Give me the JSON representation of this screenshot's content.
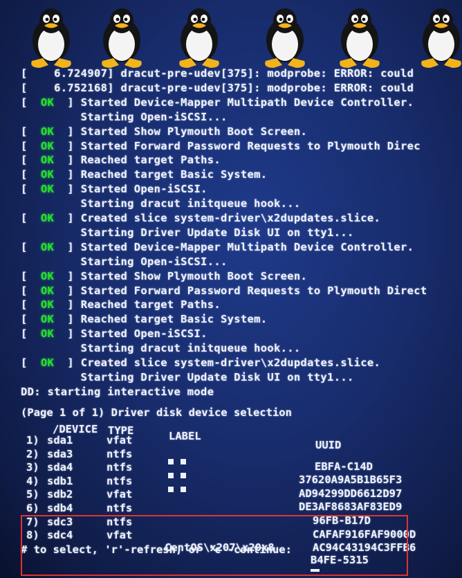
{
  "boot_log": [
    {
      "status": "",
      "text": "[    6.724907] dracut-pre-udev[375]: modprobe: ERROR: could"
    },
    {
      "status": "",
      "text": "[    6.752168] dracut-pre-udev[375]: modprobe: ERROR: could"
    },
    {
      "status": "OK",
      "text": "Started Device-Mapper Multipath Device Controller."
    },
    {
      "status": "",
      "text": "         Starting Open-iSCSI..."
    },
    {
      "status": "OK",
      "text": "Started Show Plymouth Boot Screen."
    },
    {
      "status": "OK",
      "text": "Started Forward Password Requests to Plymouth Direc"
    },
    {
      "status": "OK",
      "text": "Reached target Paths."
    },
    {
      "status": "OK",
      "text": "Reached target Basic System."
    },
    {
      "status": "OK",
      "text": "Started Open-iSCSI."
    },
    {
      "status": "",
      "text": "         Starting dracut initqueue hook..."
    },
    {
      "status": "OK",
      "text": "Created slice system-driver\\x2dupdates.slice."
    },
    {
      "status": "",
      "text": "         Starting Driver Update Disk UI on tty1..."
    },
    {
      "status": "OK",
      "text": "Started Device-Mapper Multipath Device Controller."
    },
    {
      "status": "",
      "text": "         Starting Open-iSCSI..."
    },
    {
      "status": "OK",
      "text": "Started Show Plymouth Boot Screen."
    },
    {
      "status": "OK",
      "text": "Started Forward Password Requests to Plymouth Direct"
    },
    {
      "status": "OK",
      "text": "Reached target Paths."
    },
    {
      "status": "OK",
      "text": "Reached target Basic System."
    },
    {
      "status": "OK",
      "text": "Started Open-iSCSI."
    },
    {
      "status": "",
      "text": "         Starting dracut initqueue hook..."
    },
    {
      "status": "OK",
      "text": "Created slice system-driver\\x2dupdates.slice."
    },
    {
      "status": "",
      "text": "         Starting Driver Update Disk UI on tty1..."
    },
    {
      "status": "",
      "text": "DD: starting interactive mode"
    }
  ],
  "selection": {
    "heading": "(Page 1 of 1) Driver disk device selection",
    "headers": {
      "device": "/DEVICE",
      "type": "TYPE",
      "label": "LABEL",
      "uuid": "UUID"
    },
    "rows": [
      {
        "num": "1)",
        "device": "sda1",
        "type": "vfat",
        "label": "",
        "uuid": ""
      },
      {
        "num": "2)",
        "device": "sda3",
        "type": "ntfs",
        "label": "",
        "uuid": "EBFA-C14D"
      },
      {
        "num": "3)",
        "device": "sda4",
        "type": "ntfs",
        "label": "",
        "uuid": "37620A9A5B1B65F3"
      },
      {
        "num": "4)",
        "device": "sdb1",
        "type": "ntfs",
        "label": "",
        "uuid": "AD94299DD6612D97"
      },
      {
        "num": "5)",
        "device": "sdb2",
        "type": "vfat",
        "label": "",
        "uuid": "DE3AF8683AF83ED9"
      },
      {
        "num": "6)",
        "device": "sdb4",
        "type": "ntfs",
        "label": "",
        "uuid": "96FB-B17D"
      },
      {
        "num": "7)",
        "device": "sdc3",
        "type": "ntfs",
        "label": "",
        "uuid": "CAFAF916FAF9000D"
      },
      {
        "num": "8)",
        "device": "sdc4",
        "type": "vfat",
        "label": "CentOS\\x207\\x20x8",
        "uuid": "AC94C43194C3FFB6"
      }
    ],
    "extra_uuid": "B4FE-5315",
    "prompt": "# to select, 'r'-refresh, or 'c'-continue: "
  },
  "colors": {
    "ok": "#26e22e",
    "text": "#eef2fb",
    "highlight": "#e23232"
  },
  "icons": {
    "penguin": "tux-penguin-icon"
  }
}
